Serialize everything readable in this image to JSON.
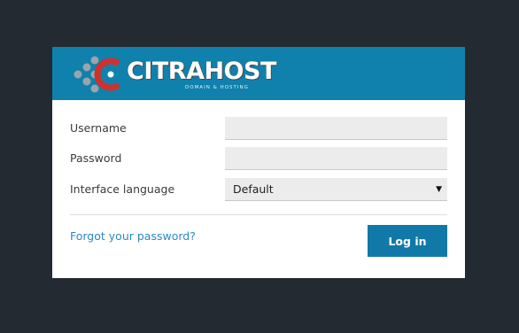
{
  "brand": {
    "name": "CITRAHOST",
    "tagline": "DOMAIN & HOSTING",
    "colors": {
      "header": "#1081ad",
      "logo_red": "#d0312d",
      "logo_dots": "#9aa4ab",
      "page_bg": "#232a31"
    }
  },
  "form": {
    "username_label": "Username",
    "username_value": "",
    "password_label": "Password",
    "password_value": "",
    "language_label": "Interface language",
    "language_selected": "Default",
    "language_arrow": "▼"
  },
  "footer": {
    "forgot_link": "Forgot your password?",
    "login_button": "Log in",
    "button_color": "#1179a8",
    "link_color": "#2a8bc4"
  }
}
